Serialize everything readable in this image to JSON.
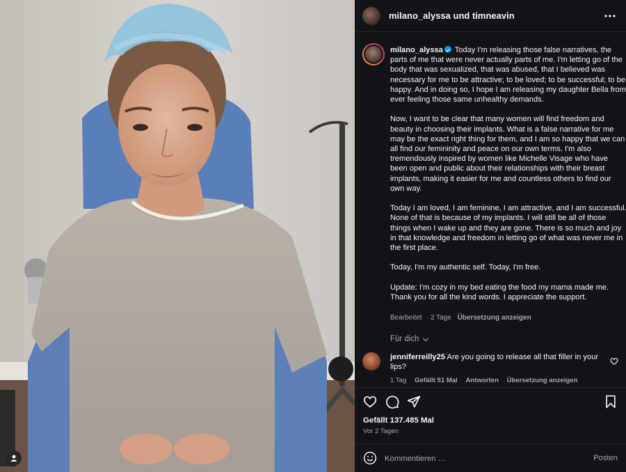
{
  "photo": {
    "alt": "",
    "icon": "person-tag-icon"
  },
  "header": {
    "author": "milano_alyssa",
    "conj": "und",
    "collaborator": "timneavin",
    "more_icon": "more-horizontal-icon"
  },
  "caption": {
    "username": "milano_alyssa",
    "verified": true,
    "paragraphs": [
      "Today I'm releasing those false narratives, the parts of me that were never actually parts of me. I'm letting go of the body that was sexualized, that was abused, that I believed was necessary for me to be attractive; to be loved; to be successful; to be happy. And in doing so, I hope I am releasing my daughter Bella from ever feeling those same unhealthy demands.",
      "Now, I want to be clear that many women will find freedom and beauty in choosing their implants. What is a false narrative for me may be the exact right thing for them, and I am so happy that we can all find our femininity and peace on our own terms. I'm also tremendously inspired by women like Michelle Visage who have been open and public about their relationships with their breast implants, making it easier for me and countless others to find our own way.",
      "Today I am loved, I am feminine, I am attractive, and I am successful. None of that is because of my implants. I will still be all of those things when I wake up and they are gone. There is so much and joy in that knowledge and freedom in letting go of what was never me in the first place.",
      "Today, I'm my authentic self. Today, I'm free.",
      "Update: I'm cozy in my bed eating the food my mama made me. Thank you for all the kind words. I appreciate the support."
    ],
    "meta_edited": "Bearbeitet",
    "meta_time": "2 Tage",
    "meta_translate": "Übersetzung anzeigen"
  },
  "for_you": "Für dich",
  "comment": {
    "username": "jenniferreilly25",
    "text": "Are you going to release all that filler in your lips?",
    "time": "1 Tag",
    "likes": "Gefällt 51 Mal",
    "reply": "Antworten",
    "translate": "Übersetzung anzeigen",
    "like_icon": "heart-outline-icon"
  },
  "actions": {
    "like_icon": "heart-icon",
    "comment_icon": "comment-icon",
    "share_icon": "share-icon",
    "save_icon": "bookmark-icon"
  },
  "likes_text": "Gefällt 137.485 Mal",
  "time_ago": "Vor 2 Tagen",
  "comment_bar": {
    "placeholder": "Kommentieren …",
    "post_label": "Posten",
    "emoji_icon": "emoji-icon"
  },
  "colors": {
    "panel_bg": "#121417",
    "text": "#f5f5f5",
    "muted": "#a8a8a8",
    "verified": "#0095f6"
  }
}
